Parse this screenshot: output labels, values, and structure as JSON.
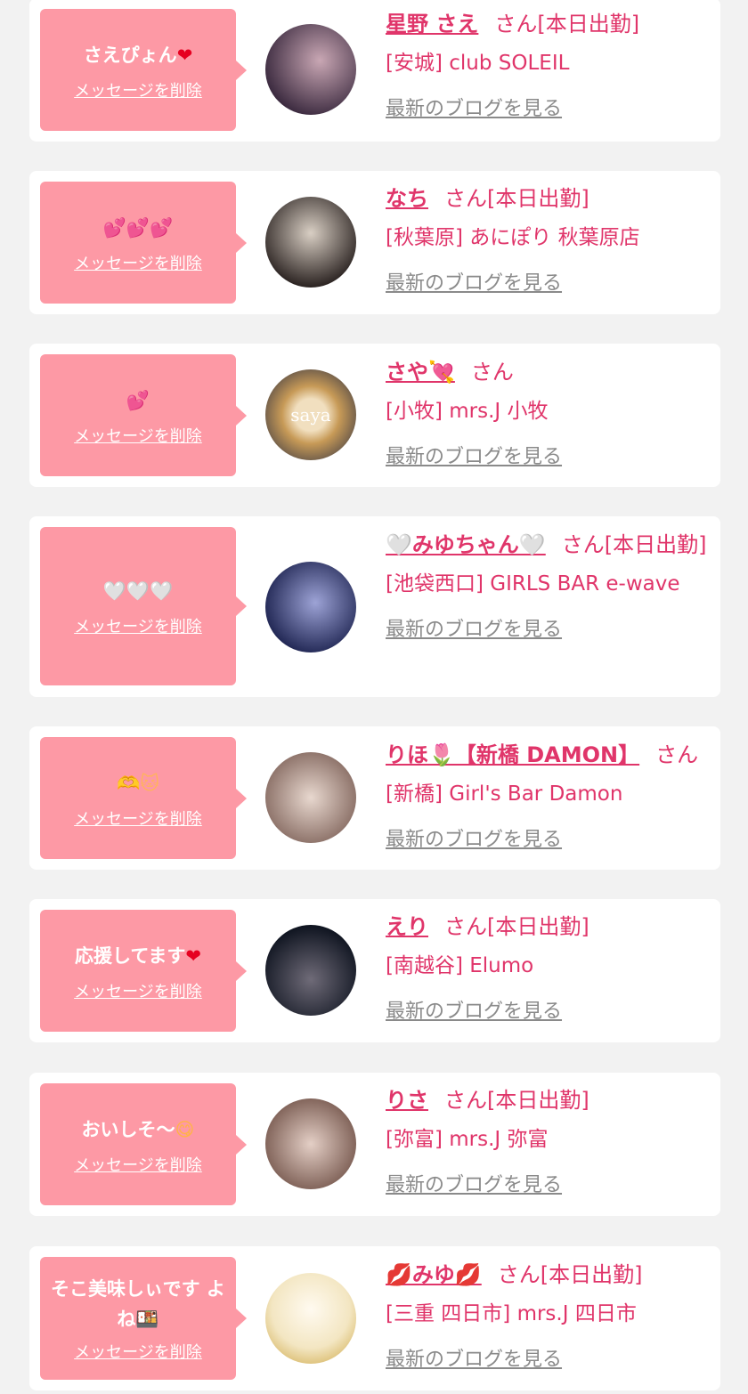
{
  "ui": {
    "delete_label": "メッセージを削除",
    "blog_label": "最新のブログを見る"
  },
  "cards": [
    {
      "message": "さえぴょん",
      "emoji": "❤",
      "name": "星野 さえ",
      "suffix": "さん[本日出勤]",
      "shop": "[安城] club SOLEIL",
      "avatar_colors": [
        "#3b2a3f",
        "#c9a7b4"
      ]
    },
    {
      "message": "",
      "emoji": "💕💕💕",
      "name": "なち",
      "suffix": "さん[本日出勤]",
      "shop": "[秋葉原] あにぽり 秋葉原店",
      "avatar_colors": [
        "#2e2624",
        "#d9cfc4"
      ]
    },
    {
      "message": "",
      "emoji": "💕",
      "name": "さや",
      "name_emoji": "💘",
      "suffix": "さん",
      "shop": "[小牧] mrs.J 小牧",
      "avatar_colors": [
        "#6b5a4a",
        "#e5c79b"
      ],
      "avatar_label": "saya"
    },
    {
      "message": "",
      "emoji": "🤍🤍🤍",
      "name": "🤍みゆちゃん🤍",
      "suffix": "さん[本日出勤]",
      "shop": "[池袋西口] GIRLS BAR e-wave",
      "avatar_colors": [
        "#1f2552",
        "#9da3d6"
      ]
    },
    {
      "message": "",
      "emoji": "🫶🐱",
      "name": "りほ🌷【新橋 DAMON】",
      "suffix": "さん",
      "shop": "[新橋] Girl's Bar Damon",
      "avatar_colors": [
        "#8a6f66",
        "#e8d8cf"
      ]
    },
    {
      "message": "応援してます",
      "emoji": "❤",
      "name": "えり",
      "suffix": "さん[本日出勤]",
      "shop": "[南越谷] Elumo",
      "avatar_colors": [
        "#101521",
        "#6f6b78"
      ]
    },
    {
      "message": "おいしそ〜",
      "emoji": "😋",
      "name": "りさ",
      "suffix": "さん[本日出勤]",
      "shop": "[弥富] mrs.J 弥富",
      "avatar_colors": [
        "#7d5f55",
        "#e4cfc6"
      ]
    },
    {
      "message": "そこ美味しぃです よね",
      "emoji": "🍱",
      "name": "💋みゆ💋",
      "suffix": "さん[本日出勤]",
      "shop": "[三重 四日市] mrs.J 四日市",
      "avatar_colors": [
        "#f3e6c2",
        "#fffaf0"
      ]
    }
  ]
}
